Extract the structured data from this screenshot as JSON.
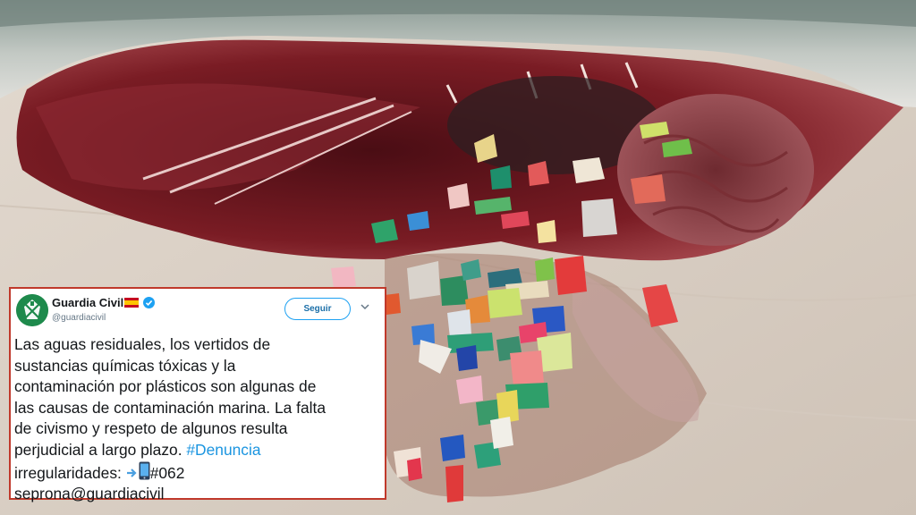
{
  "colors": {
    "card_border": "#c0392b",
    "follow_button_text": "#1b6fa8",
    "hashtag": "#1b95e0",
    "avatar_bg": "#1e8a4c",
    "verified_badge": "#1da1f2"
  },
  "icons": {
    "avatar": "guardia-civil-emblem",
    "flag": "spain-flag",
    "verified": "verified-badge",
    "menu": "chevron-down",
    "inline": [
      "arrow-right-icon",
      "mobile-phone-icon"
    ]
  },
  "tweet": {
    "account_name": "Guardia Civil",
    "handle": "@guardiacivil",
    "follow_label": "Seguir",
    "lines": [
      "Las aguas residuales, los vertidos de",
      "sustancias químicas tóxicas y la",
      "contaminación por plásticos son algunas de",
      "las causas de contaminación marina. La falta",
      "de civismo y respeto de algunos resulta"
    ],
    "line6_text": "perjudicial a largo plazo.",
    "hashtag": "#Denuncia",
    "line7_text": "irregularidades:",
    "line7_code": "#062",
    "line8_text": "seprona@guardiacivil"
  }
}
